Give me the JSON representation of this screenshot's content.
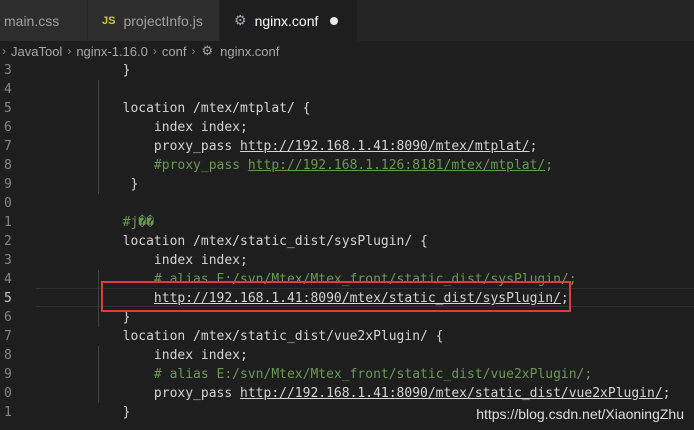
{
  "tabs": [
    {
      "label": "main.css",
      "active": false
    },
    {
      "label": "projectInfo.js",
      "active": false,
      "icon": "js-icon"
    },
    {
      "label": "nginx.conf",
      "active": true,
      "icon": "gear-icon",
      "dirty": true
    }
  ],
  "breadcrumb": [
    "JavaTool",
    "nginx-1.16.0",
    "conf",
    "nginx.conf"
  ],
  "line_numbers": [
    "3",
    "4",
    "5",
    "6",
    "7",
    "8",
    "9",
    "0",
    "1",
    "2",
    "3",
    "4",
    "5",
    "6",
    "7",
    "8",
    "9",
    "0",
    "1"
  ],
  "current_line_index": 12,
  "code_lines": [
    {
      "text": "        }"
    },
    {
      "text": ""
    },
    {
      "text": "        location /mtex/mtplat/ {"
    },
    {
      "pre": "            index index;"
    },
    {
      "pre": "            proxy_pass ",
      "url": "http://192.168.1.41:8090/mtex/mtplat/",
      "post": ";"
    },
    {
      "comment": "            #proxy_pass ",
      "curl": "http://192.168.1.126:8181/mtex/mtplat/",
      "cpost": ";"
    },
    {
      "text": "         }"
    },
    {
      "text": ""
    },
    {
      "comment_text": "        #j��"
    },
    {
      "text": "        location /mtex/static_dist/sysPlugin/ {"
    },
    {
      "pre": "            index index;"
    },
    {
      "comment_text": "            # alias E:/svn/Mtex/Mtex_front/static_dist/sysPlugin/;"
    },
    {
      "pre": "            ",
      "url": "http://192.168.1.41:8090/mtex/static_dist/sysPlugin/",
      "post": ";"
    },
    {
      "text": "        }"
    },
    {
      "text": "        location /mtex/static_dist/vue2xPlugin/ {"
    },
    {
      "pre": "            index index;"
    },
    {
      "comment_text": "            # alias E:/svn/Mtex/Mtex_front/static_dist/vue2xPlugin/;"
    },
    {
      "pre": "            proxy_pass ",
      "url": "http://192.168.1.41:8090/mtex/static_dist/vue2xPlugin/",
      "post": ";"
    },
    {
      "text": "        }"
    }
  ],
  "watermark": "https://blog.csdn.net/XiaoningZhu",
  "colors": {
    "comment": "#6a9955",
    "text": "#d4d4d4",
    "highlight_box": "#e03a3a"
  }
}
